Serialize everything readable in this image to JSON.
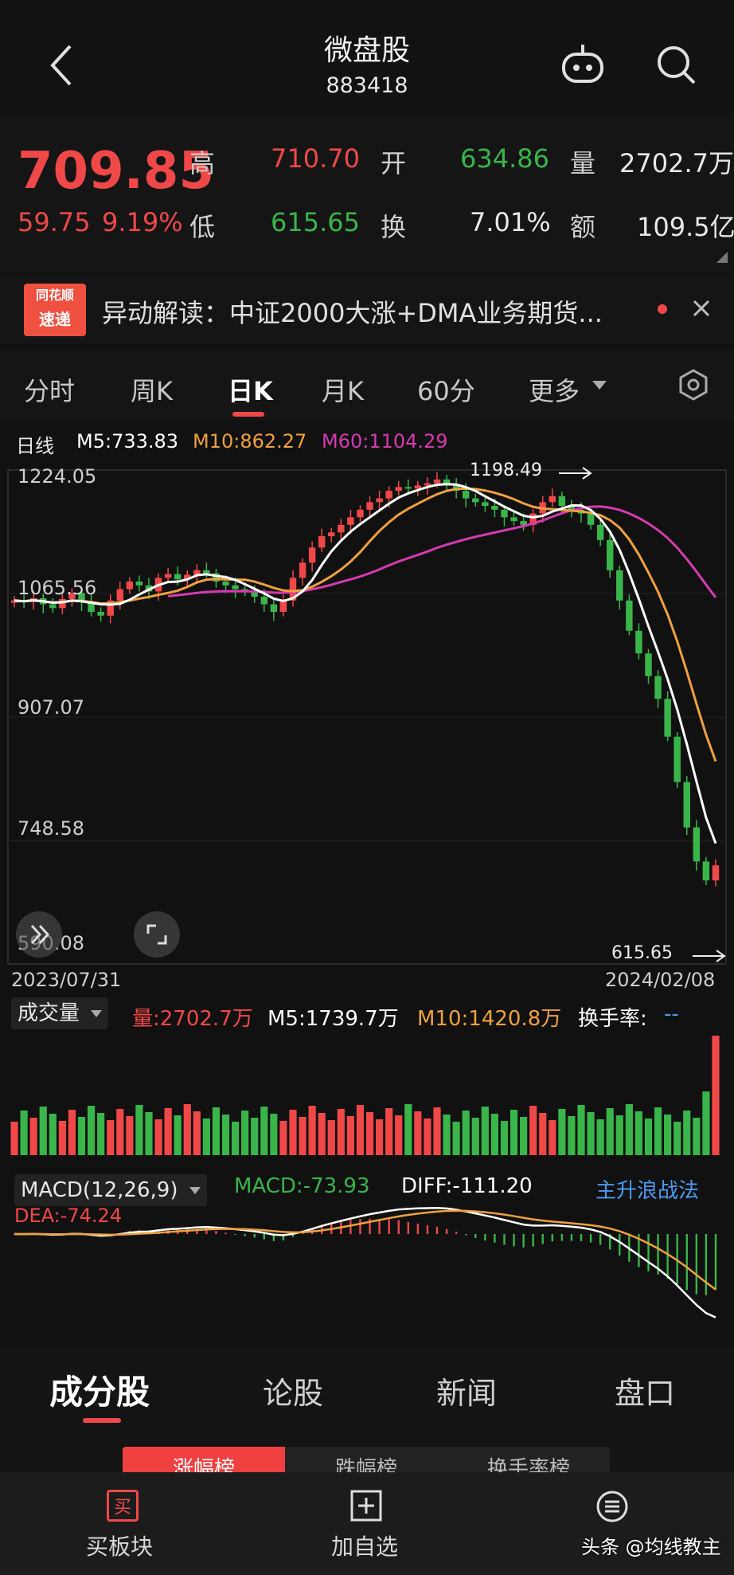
{
  "header": {
    "title": "微盘股",
    "code": "883418"
  },
  "quote": {
    "price": "709.85",
    "change": "59.75",
    "change_pct": "9.19%",
    "high_label": "高",
    "high": "710.70",
    "low_label": "低",
    "low": "615.65",
    "open_label": "开",
    "open": "634.86",
    "turnover_label": "换",
    "turnover": "7.01%",
    "volume_label": "量",
    "volume": "2702.7万",
    "amount_label": "额",
    "amount": "109.5亿"
  },
  "news": {
    "logo_top": "同花顺",
    "logo_bottom": "速递",
    "text": "异动解读：中证2000大涨+DMA业务期货..."
  },
  "ktabs": [
    "分时",
    "周K",
    "日K",
    "月K",
    "60分",
    "更多"
  ],
  "ma_legend": {
    "label": "日线",
    "m5": "M5:733.83",
    "m10": "M10:862.27",
    "m60": "M60:1104.29"
  },
  "price_axis": [
    "1224.05",
    "1065.56",
    "907.07",
    "748.58",
    "590.08"
  ],
  "marks": {
    "high": "1198.49",
    "low": "615.65"
  },
  "dates": {
    "start": "2023/07/31",
    "end": "2024/02/08"
  },
  "volume_legend": {
    "select": "成交量",
    "vol": "量:2702.7万",
    "m5": "M5:1739.7万",
    "m10": "M10:1420.8万",
    "turn": "换手率:",
    "turn_val": "--"
  },
  "macd_legend": {
    "select": "MACD(12,26,9)",
    "macd": "MACD:-73.93",
    "diff": "DIFF:-111.20",
    "strategy": "主升浪战法",
    "dea": "DEA:-74.24"
  },
  "sections": [
    "成分股",
    "论股",
    "新闻",
    "盘口"
  ],
  "sub_tabs": [
    "涨幅榜",
    "跌幅榜",
    "换手率榜"
  ],
  "bottom_nav": [
    {
      "label": "买板块",
      "icon": "buy-icon"
    },
    {
      "label": "加自选",
      "icon": "plus-box-icon"
    },
    {
      "label": "头条",
      "icon": "menu-icon"
    }
  ],
  "watermark": "头条 @均线教主",
  "colors": {
    "up": "#f04848",
    "down": "#39b54a",
    "ma5": "#ffffff",
    "ma10": "#f0a040",
    "ma60": "#d63ab0"
  },
  "chart_data": {
    "type": "candlestick",
    "y_range": [
      590.08,
      1224.05
    ],
    "close_series": [
      1060,
      1058,
      1063,
      1055,
      1050,
      1062,
      1070,
      1058,
      1045,
      1040,
      1060,
      1075,
      1085,
      1080,
      1072,
      1090,
      1095,
      1088,
      1094,
      1100,
      1096,
      1085,
      1080,
      1075,
      1072,
      1065,
      1055,
      1045,
      1060,
      1090,
      1110,
      1130,
      1145,
      1150,
      1160,
      1170,
      1180,
      1190,
      1195,
      1205,
      1210,
      1208,
      1212,
      1215,
      1220,
      1214,
      1205,
      1195,
      1190,
      1185,
      1180,
      1170,
      1165,
      1160,
      1175,
      1190,
      1198,
      1185,
      1180,
      1175,
      1160,
      1140,
      1100,
      1060,
      1020,
      990,
      960,
      930,
      880,
      820,
      760,
      715,
      690,
      709.85
    ]
  }
}
